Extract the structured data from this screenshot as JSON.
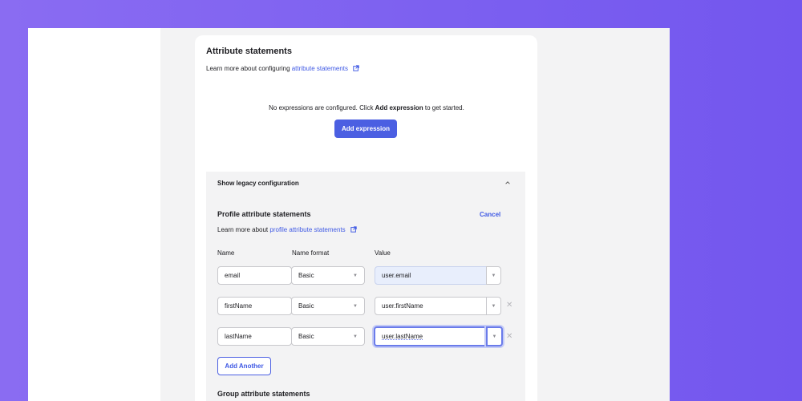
{
  "section": {
    "title": "Attribute statements",
    "learn_prefix": "Learn more about configuring ",
    "learn_link": "attribute statements",
    "empty_prefix": "No expressions are configured. Click ",
    "empty_bold": "Add expression",
    "empty_suffix": " to get started.",
    "add_expression_label": "Add expression"
  },
  "legacy": {
    "header": "Show legacy configuration",
    "profile_title": "Profile attribute statements",
    "cancel_label": "Cancel",
    "learn_prefix": "Learn more about ",
    "learn_link": "profile attribute statements",
    "columns": {
      "name": "Name",
      "format": "Name format",
      "value": "Value"
    },
    "rows": [
      {
        "name": "email",
        "format": "Basic",
        "value": "user.email"
      },
      {
        "name": "firstName",
        "format": "Basic",
        "value": "user.firstName"
      },
      {
        "name": "lastName",
        "format": "Basic",
        "value": "user.lastName"
      }
    ],
    "add_another_label": "Add Another",
    "group_title": "Group attribute statements"
  },
  "colors": {
    "primary": "#4b5fe2",
    "link": "#3f59e4",
    "background_gradient": "#8a6cf2",
    "readonly_value": "#e8eefc"
  }
}
